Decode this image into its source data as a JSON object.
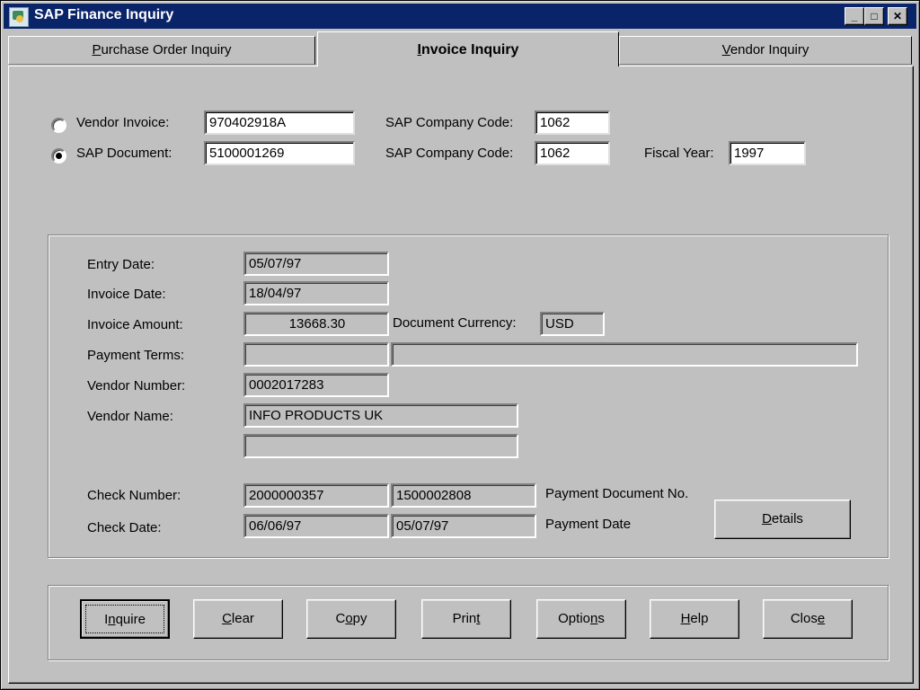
{
  "window": {
    "title": "SAP Finance Inquiry",
    "controls": [
      "minimize",
      "maximize",
      "close"
    ]
  },
  "tabs": [
    {
      "label": "Purchase Order Inquiry",
      "mnemonic": "P",
      "active": false
    },
    {
      "label": "Invoice Inquiry",
      "mnemonic": "I",
      "active": true
    },
    {
      "label": "Vendor Inquiry",
      "mnemonic": "V",
      "active": false
    }
  ],
  "search": {
    "vendor_invoice_label": "Vendor Invoice:",
    "vendor_invoice_value": "970402918A",
    "vendor_invoice_selected": false,
    "sap_document_label": "SAP Document:",
    "sap_document_value": "5100001269",
    "sap_document_selected": true,
    "company_code_label": "SAP Company Code:",
    "company_code_1": "1062",
    "company_code_2": "1062",
    "fiscal_year_label": "Fiscal Year:",
    "fiscal_year_value": "1997"
  },
  "details": {
    "entry_date_label": "Entry Date:",
    "entry_date": "05/07/97",
    "invoice_date_label": "Invoice Date:",
    "invoice_date": "18/04/97",
    "invoice_amount_label": "Invoice Amount:",
    "invoice_amount": "13668.30",
    "document_currency_label": "Document Currency:",
    "document_currency": "USD",
    "payment_terms_label": "Payment Terms:",
    "payment_terms_code": "",
    "payment_terms_text": "",
    "vendor_number_label": "Vendor Number:",
    "vendor_number": "0002017283",
    "vendor_name_label": "Vendor Name:",
    "vendor_name_1": "INFO PRODUCTS UK",
    "vendor_name_2": "",
    "check_number_label": "Check Number:",
    "check_number": "2000000357",
    "payment_document_no": "1500002808",
    "payment_document_no_label": "Payment Document No.",
    "check_date_label": "Check Date:",
    "check_date": "06/06/97",
    "payment_date": "05/07/97",
    "payment_date_label": "Payment Date",
    "details_button": "Details"
  },
  "buttons": [
    {
      "label": "Inquire"
    },
    {
      "label": "Clear"
    },
    {
      "label": "Copy"
    },
    {
      "label": "Print"
    },
    {
      "label": "Options"
    },
    {
      "label": "Help"
    },
    {
      "label": "Close"
    }
  ]
}
